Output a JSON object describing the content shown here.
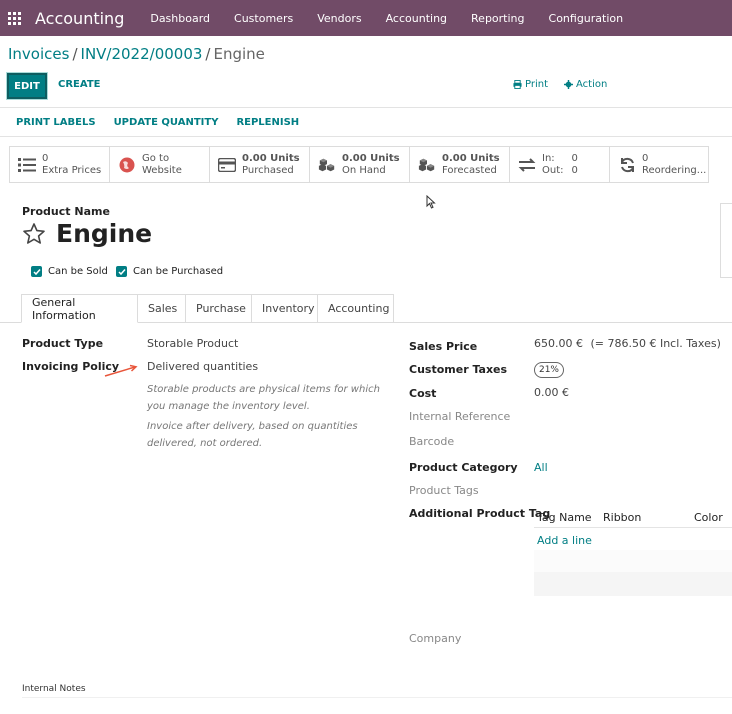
{
  "topnav": {
    "app_title": "Accounting",
    "menu": [
      "Dashboard",
      "Customers",
      "Vendors",
      "Accounting",
      "Reporting",
      "Configuration"
    ]
  },
  "breadcrumb": {
    "items": [
      "Invoices",
      "INV/2022/00003"
    ],
    "current": "Engine"
  },
  "toolbar": {
    "edit_label": "EDIT",
    "create_label": "CREATE",
    "print_label": "Print",
    "action_label": "Action"
  },
  "statusbar": {
    "buttons": [
      "PRINT LABELS",
      "UPDATE QUANTITY",
      "REPLENISH"
    ]
  },
  "smart_buttons": [
    {
      "icon": "list-icon",
      "value": "0",
      "label": "Extra Prices"
    },
    {
      "icon": "globe-icon",
      "value": "Go to",
      "label": "Website"
    },
    {
      "icon": "credit-card-icon",
      "value": "0.00 Units",
      "label": "Purchased"
    },
    {
      "icon": "cubes-icon",
      "value": "0.00 Units",
      "label": "On Hand"
    },
    {
      "icon": "cubes-icon",
      "value": "0.00 Units",
      "label": "Forecasted"
    },
    {
      "icon": "exchange-icon",
      "in_label": "In:",
      "in_value": "0",
      "out_label": "Out:",
      "out_value": "0"
    },
    {
      "icon": "refresh-icon",
      "value": "0",
      "label": "Reordering..."
    }
  ],
  "form": {
    "product_name_label": "Product Name",
    "product_name": "Engine",
    "can_be_sold": "Can be Sold",
    "can_be_purchased": "Can be Purchased",
    "tabs": [
      "General Information",
      "Sales",
      "Purchase",
      "Inventory",
      "Accounting"
    ],
    "left": {
      "product_type_label": "Product Type",
      "product_type_value": "Storable Product",
      "invoicing_policy_label": "Invoicing Policy",
      "invoicing_policy_value": "Delivered quantities",
      "help1_line1": "Storable products are physical items for which",
      "help1_line2": "you manage the inventory level.",
      "help2_line1": "Invoice after delivery, based on quantities",
      "help2_line2": "delivered, not ordered."
    },
    "right": {
      "sales_price_label": "Sales Price",
      "sales_price_value": "650.00 €",
      "sales_price_incl": "(= 786.50 € Incl. Taxes)",
      "customer_taxes_label": "Customer Taxes",
      "customer_taxes_value": "21%",
      "cost_label": "Cost",
      "cost_value": "0.00 €",
      "internal_reference_label": "Internal Reference",
      "barcode_label": "Barcode",
      "product_category_label": "Product Category",
      "product_category_value": "All",
      "product_tags_label": "Product Tags",
      "additional_tag_label": "Additional Product Tag",
      "tag_columns": [
        "Tag Name",
        "Ribbon",
        "Color"
      ],
      "add_line": "Add a line",
      "company_label": "Company"
    },
    "internal_notes_label": "Internal Notes"
  },
  "colors": {
    "brand": "#714b67",
    "accent": "#017e84",
    "annotation": "#e8553a"
  }
}
